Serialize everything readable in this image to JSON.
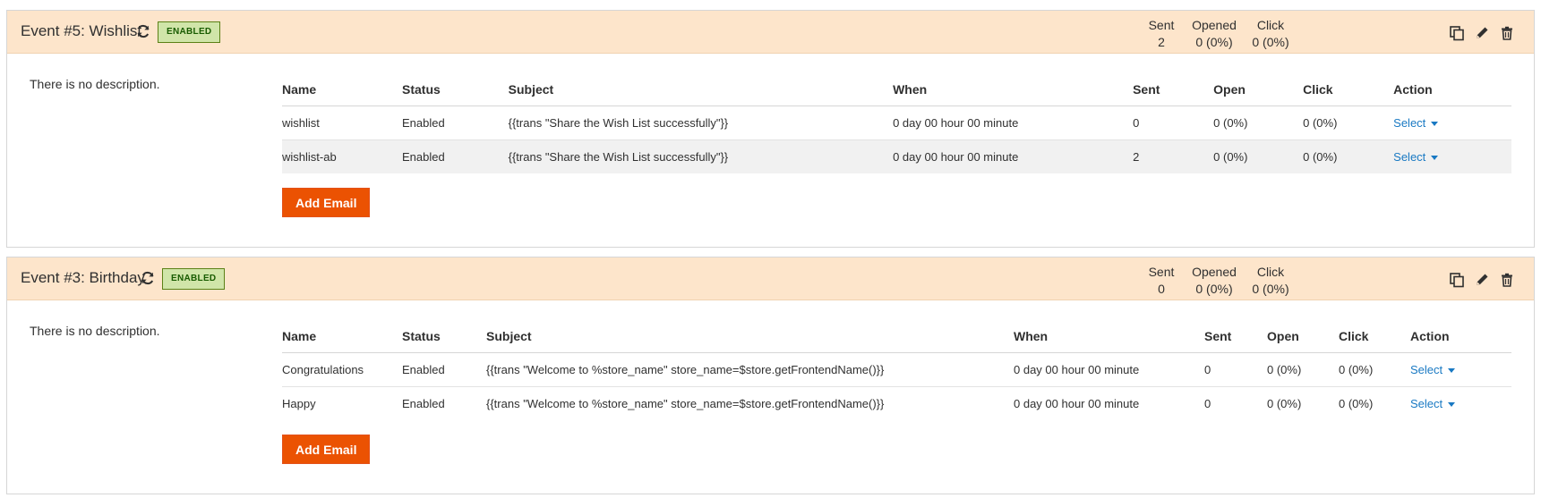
{
  "events": [
    {
      "title": "Event #5: Wishlist",
      "status_badge": "ENABLED",
      "stats": {
        "sent_label": "Sent",
        "sent_value": "2",
        "opened_label": "Opened",
        "opened_value": "0 (0%)",
        "click_label": "Click",
        "click_value": "0 (0%)"
      },
      "description": "There is no description.",
      "columns": [
        "Name",
        "Status",
        "Subject",
        "When",
        "Sent",
        "Open",
        "Click",
        "Action"
      ],
      "rows": [
        {
          "name": "wishlist",
          "status": "Enabled",
          "subject": "{{trans \"Share the Wish List successfully\"}}",
          "when": "0 day 00 hour 00 minute",
          "sent": "0",
          "open": "0 (0%)",
          "click": "0 (0%)",
          "action": "Select"
        },
        {
          "name": "wishlist-ab",
          "status": "Enabled",
          "subject": "{{trans \"Share the Wish List successfully\"}}",
          "when": "0 day 00 hour 00 minute",
          "sent": "2",
          "open": "0 (0%)",
          "click": "0 (0%)",
          "action": "Select"
        }
      ],
      "add_email_label": "Add Email"
    },
    {
      "title": "Event #3: Birthday",
      "status_badge": "ENABLED",
      "stats": {
        "sent_label": "Sent",
        "sent_value": "0",
        "opened_label": "Opened",
        "opened_value": "0 (0%)",
        "click_label": "Click",
        "click_value": "0 (0%)"
      },
      "description": "There is no description.",
      "columns": [
        "Name",
        "Status",
        "Subject",
        "When",
        "Sent",
        "Open",
        "Click",
        "Action"
      ],
      "rows": [
        {
          "name": "Congratulations",
          "status": "Enabled",
          "subject": "{{trans \"Welcome to %store_name\" store_name=$store.getFrontendName()}}",
          "when": "0 day 00 hour 00 minute",
          "sent": "0",
          "open": "0 (0%)",
          "click": "0 (0%)",
          "action": "Select"
        },
        {
          "name": "Happy",
          "status": "Enabled",
          "subject": "{{trans \"Welcome to %store_name\" store_name=$store.getFrontendName()}}",
          "when": "0 day 00 hour 00 minute",
          "sent": "0",
          "open": "0 (0%)",
          "click": "0 (0%)",
          "action": "Select"
        }
      ],
      "add_email_label": "Add Email"
    }
  ],
  "icons": {
    "refresh": "refresh-icon",
    "duplicate": "duplicate-icon",
    "edit": "pencil-icon",
    "delete": "trash-icon",
    "dropdown": "caret-down-icon"
  },
  "colors": {
    "header_bg": "#fde5cb",
    "badge_bg": "#d0e5a9",
    "badge_text": "#185b00",
    "primary_button": "#eb5202",
    "link": "#1979c3"
  }
}
